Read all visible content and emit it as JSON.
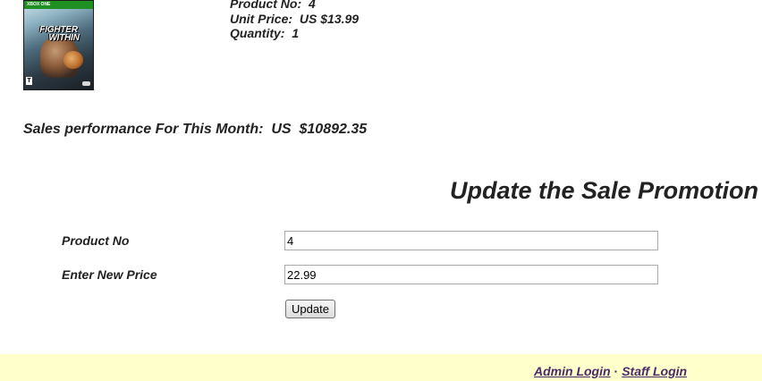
{
  "product": {
    "cover": {
      "platform_label": "XBOX ONE",
      "title_line_1": "FIGHTER",
      "title_line_2": "WITHIN",
      "rating": "T"
    },
    "product_no_label": "Product No:",
    "product_no_value": "4",
    "unit_price_label": "Unit Price:",
    "unit_price_value": "US $13.99",
    "quantity_label": "Quantity:",
    "quantity_value": "1"
  },
  "sales": {
    "label": "Sales performance For This Month:",
    "currency": "US",
    "amount": "$10892.35"
  },
  "promotion": {
    "heading": "Update the Sale Promotion",
    "product_no_label": "Product No",
    "product_no_value": "4",
    "price_label": "Enter New Price",
    "price_value": "22.99",
    "update_button_label": "Update"
  },
  "footer": {
    "admin_login": "Admin Login",
    "separator": "·",
    "staff_login": "Staff Login",
    "background": "#ffffcc",
    "link_color": "#4b2a6b"
  }
}
